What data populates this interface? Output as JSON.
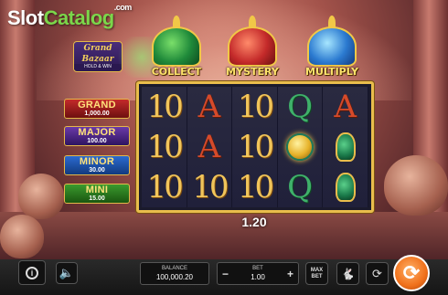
{
  "brand": {
    "logo_a": "Slot",
    "logo_b": "Catalog",
    "logo_sup": ".com"
  },
  "game_logo": {
    "line1": "Grand",
    "line2": "Bazaar",
    "line3": "HOLD & WIN"
  },
  "jackpots": [
    {
      "name": "GRAND",
      "value": "1,000.00",
      "color": "#c42a2a"
    },
    {
      "name": "MAJOR",
      "value": "100.00",
      "color": "#6a3aa8"
    },
    {
      "name": "MINOR",
      "value": "30.00",
      "color": "#2b6ad0"
    },
    {
      "name": "MINI",
      "value": "15.00",
      "color": "#3a9a2e"
    }
  ],
  "domes": [
    {
      "label": "COLLECT",
      "color": "#1f8a3a"
    },
    {
      "label": "MYSTERY",
      "color": "#c42a2a"
    },
    {
      "label": "MULTIPLY",
      "color": "#2b7ad0"
    }
  ],
  "reels": [
    [
      "10",
      "A",
      "10",
      "Q",
      "A"
    ],
    [
      "10",
      "A",
      "10",
      "coin",
      "vase"
    ],
    [
      "10",
      "10",
      "10",
      "Q",
      "vase"
    ]
  ],
  "win_amount": "1.20",
  "controls": {
    "balance_label": "BALANCE",
    "balance_value": "100,000.20",
    "bet_label": "BET",
    "bet_value": "1.00",
    "bet_minus": "−",
    "bet_plus": "+",
    "maxbet_label": "MAX BET",
    "info_icon": "i",
    "sound_icon": "speaker-icon",
    "turbo_icon": "rabbit-icon",
    "auto_icon": "autoplay-icon",
    "spin_icon": "spin-icon"
  },
  "colors": {
    "frame_gold": "#e9bd4c",
    "spin_orange": "#f0701a",
    "logo_green": "#7bd64a"
  }
}
